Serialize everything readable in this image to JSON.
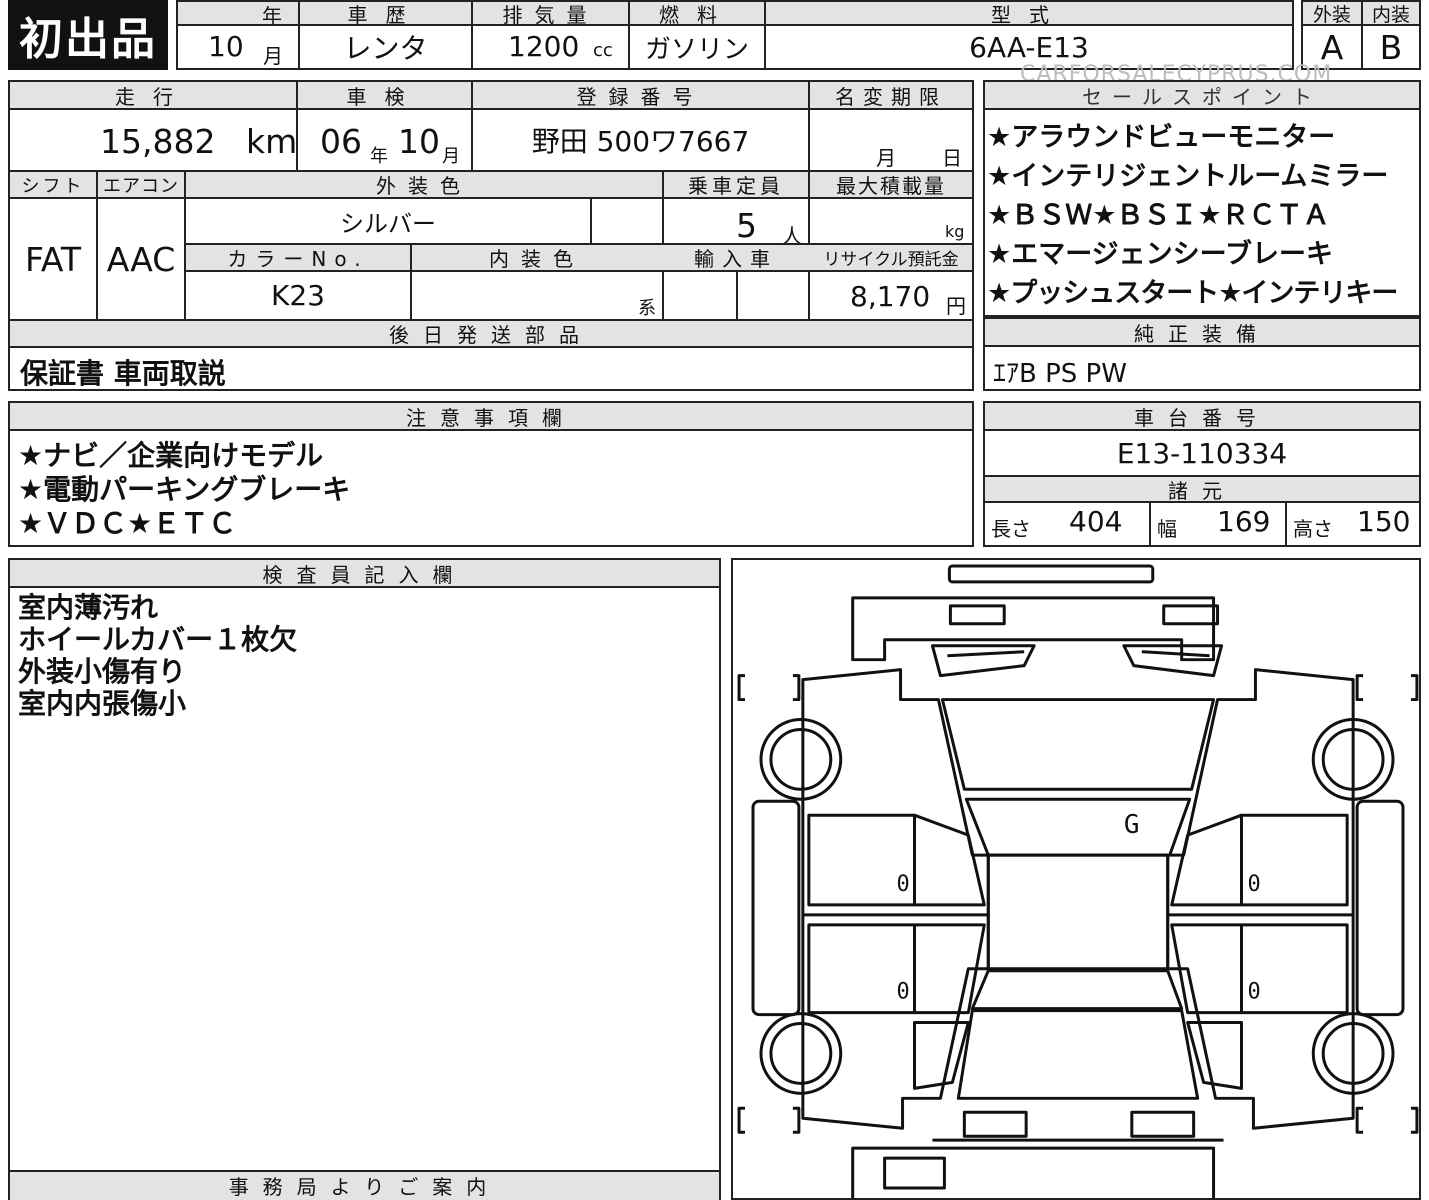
{
  "watermark": "CARFORSALECYPRUS.COM",
  "first_reg": {
    "badge": "初出品",
    "year_label": "年",
    "month_value": "10",
    "month_unit": "月"
  },
  "history": {
    "label": "車歴",
    "value": "レンタ"
  },
  "displacement": {
    "label": "排気量",
    "value": "1200",
    "unit": "cc"
  },
  "fuel": {
    "label": "燃料",
    "value": "ガソリン"
  },
  "model": {
    "label": "型式",
    "value": "6AA-E13"
  },
  "grades": {
    "exterior_label": "外装",
    "exterior_value": "A",
    "interior_label": "内装",
    "interior_value": "B"
  },
  "mileage": {
    "label": "走行",
    "value": "15,882",
    "unit": "km"
  },
  "inspection": {
    "label": "車検",
    "year": "06",
    "year_unit": "年",
    "month": "10",
    "month_unit": "月"
  },
  "registration": {
    "label": "登録番号",
    "value": "野田 500ワ7667"
  },
  "name_change": {
    "label": "名変期限",
    "month_unit": "月",
    "day_unit": "日"
  },
  "shift": {
    "label": "シフト",
    "value": "FAT"
  },
  "aircon": {
    "label": "エアコン",
    "value": "AAC"
  },
  "ext_color": {
    "label": "外装色",
    "value": "シルバー"
  },
  "capacity": {
    "label": "乗車定員",
    "value": "5",
    "unit": "人"
  },
  "max_load": {
    "label": "最大積載量",
    "unit": "kg"
  },
  "color_no": {
    "label": "カラーNo.",
    "value": "K23"
  },
  "int_color": {
    "label": "内装色",
    "unit": "系"
  },
  "import": {
    "label": "輸入車"
  },
  "recycle": {
    "label": "リサイクル預託金",
    "value": "8,170",
    "unit": "円"
  },
  "sales_points": {
    "label": "セールスポイント",
    "items": [
      "★アラウンドビューモニター",
      "★インテリジェントルームミラー",
      "★ＢＳＷ★ＢＳＩ★ＲＣＴＡ",
      "★エマージェンシーブレーキ",
      "★プッシュスタート★インテリキー"
    ]
  },
  "later_parts": {
    "label": "後日発送部品",
    "value": "保証書 車両取説"
  },
  "genuine_equip": {
    "label": "純正装備",
    "value": "ｴｱB PS PW"
  },
  "notes": {
    "label": "注意事項欄",
    "items": [
      "★ナビ／企業向けモデル",
      "★電動パーキングブレーキ",
      "★ＶＤＣ★ＥＴＣ"
    ]
  },
  "chassis": {
    "label": "車台番号",
    "value": "E13-110334"
  },
  "specs": {
    "label": "諸元",
    "length_label": "長さ",
    "length": "404",
    "width_label": "幅",
    "width": "169",
    "height_label": "高さ",
    "height": "150"
  },
  "inspector": {
    "label": "検査員記入欄",
    "items": [
      "室内薄汚れ",
      "ホイールカバー１枚欠",
      "外装小傷有り",
      "室内内張傷小"
    ]
  },
  "office": {
    "label": "事務局よりご案内"
  },
  "diagram": {
    "mark_roof": "G",
    "mark_f_left": "0",
    "mark_f_right": "0",
    "mark_r_left": "0",
    "mark_r_right": "0"
  }
}
